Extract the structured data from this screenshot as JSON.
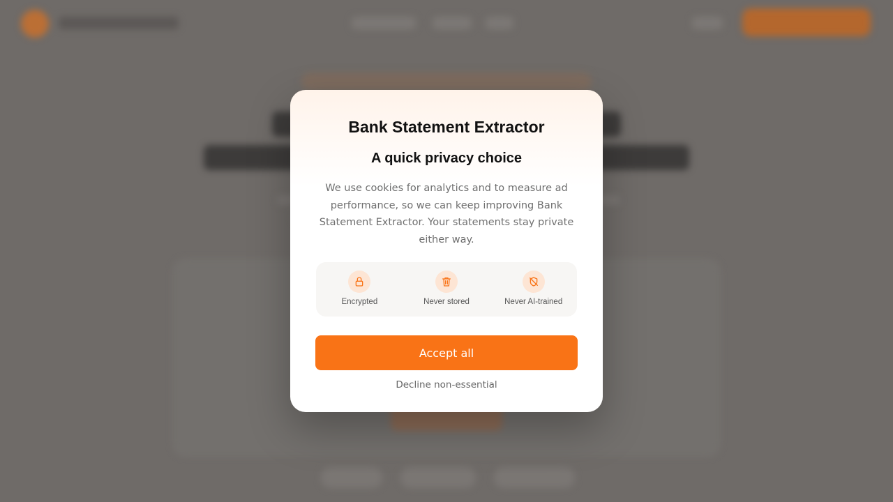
{
  "modal": {
    "title": "Bank Statement Extractor",
    "subtitle": "A quick privacy choice",
    "body": "We use cookies for analytics and to measure ad performance, so we can keep improving Bank Statement Extractor. Your statements stay private either way.",
    "features": [
      {
        "icon": "lock-icon",
        "label": "Encrypted"
      },
      {
        "icon": "trash-icon",
        "label": "Never stored"
      },
      {
        "icon": "shield-off-icon",
        "label": "Never AI-trained"
      }
    ],
    "accept_label": "Accept all",
    "decline_label": "Decline non-essential"
  },
  "colors": {
    "accent": "#f97316",
    "icon_bg": "#fde5d4",
    "overlay": "#6f6b68"
  }
}
